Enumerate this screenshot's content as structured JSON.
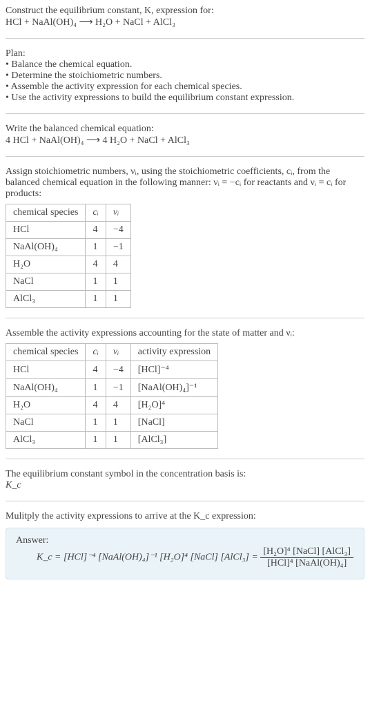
{
  "intro": {
    "line1": "Construct the equilibrium constant, K, expression for:",
    "equation": "HCl + NaAl(OH)₄  ⟶  H₂O + NaCl + AlCl₃"
  },
  "plan": {
    "heading": "Plan:",
    "b1": "• Balance the chemical equation.",
    "b2": "• Determine the stoichiometric numbers.",
    "b3": "• Assemble the activity expression for each chemical species.",
    "b4": "• Use the activity expressions to build the equilibrium constant expression."
  },
  "balanced": {
    "lead": "Write the balanced chemical equation:",
    "equation": "4 HCl + NaAl(OH)₄  ⟶  4 H₂O + NaCl + AlCl₃"
  },
  "stoich_text": "Assign stoichiometric numbers, νᵢ, using the stoichiometric coefficients, cᵢ, from the balanced chemical equation in the following manner: νᵢ = −cᵢ for reactants and νᵢ = cᵢ for products:",
  "table1": {
    "h1": "chemical species",
    "h2": "cᵢ",
    "h3": "νᵢ",
    "rows": [
      {
        "s": "HCl",
        "c": "4",
        "v": "−4"
      },
      {
        "s": "NaAl(OH)₄",
        "c": "1",
        "v": "−1"
      },
      {
        "s": "H₂O",
        "c": "4",
        "v": "4"
      },
      {
        "s": "NaCl",
        "c": "1",
        "v": "1"
      },
      {
        "s": "AlCl₃",
        "c": "1",
        "v": "1"
      }
    ]
  },
  "activity_text": "Assemble the activity expressions accounting for the state of matter and νᵢ:",
  "table2": {
    "h1": "chemical species",
    "h2": "cᵢ",
    "h3": "νᵢ",
    "h4": "activity expression",
    "rows": [
      {
        "s": "HCl",
        "c": "4",
        "v": "−4",
        "a": "[HCl]⁻⁴"
      },
      {
        "s": "NaAl(OH)₄",
        "c": "1",
        "v": "−1",
        "a": "[NaAl(OH)₄]⁻¹"
      },
      {
        "s": "H₂O",
        "c": "4",
        "v": "4",
        "a": "[H₂O]⁴"
      },
      {
        "s": "NaCl",
        "c": "1",
        "v": "1",
        "a": "[NaCl]"
      },
      {
        "s": "AlCl₃",
        "c": "1",
        "v": "1",
        "a": "[AlCl₃]"
      }
    ]
  },
  "kc_symbol": {
    "line1": "The equilibrium constant symbol in the concentration basis is:",
    "line2": "K_c"
  },
  "multiply_text": "Mulitply the activity expressions to arrive at the K_c expression:",
  "answer": {
    "label": "Answer:",
    "lhs": "K_c = [HCl]⁻⁴ [NaAl(OH)₄]⁻¹ [H₂O]⁴ [NaCl] [AlCl₃] = ",
    "num": "[H₂O]⁴ [NaCl] [AlCl₃]",
    "den": "[HCl]⁴ [NaAl(OH)₄]"
  },
  "chart_data": {
    "type": "table",
    "tables": [
      {
        "title": "stoichiometric numbers",
        "columns": [
          "chemical species",
          "c_i",
          "ν_i"
        ],
        "rows": [
          [
            "HCl",
            4,
            -4
          ],
          [
            "NaAl(OH)4",
            1,
            -1
          ],
          [
            "H2O",
            4,
            4
          ],
          [
            "NaCl",
            1,
            1
          ],
          [
            "AlCl3",
            1,
            1
          ]
        ]
      },
      {
        "title": "activity expressions",
        "columns": [
          "chemical species",
          "c_i",
          "ν_i",
          "activity expression"
        ],
        "rows": [
          [
            "HCl",
            4,
            -4,
            "[HCl]^-4"
          ],
          [
            "NaAl(OH)4",
            1,
            -1,
            "[NaAl(OH)4]^-1"
          ],
          [
            "H2O",
            4,
            4,
            "[H2O]^4"
          ],
          [
            "NaCl",
            1,
            1,
            "[NaCl]"
          ],
          [
            "AlCl3",
            1,
            1,
            "[AlCl3]"
          ]
        ]
      }
    ]
  }
}
